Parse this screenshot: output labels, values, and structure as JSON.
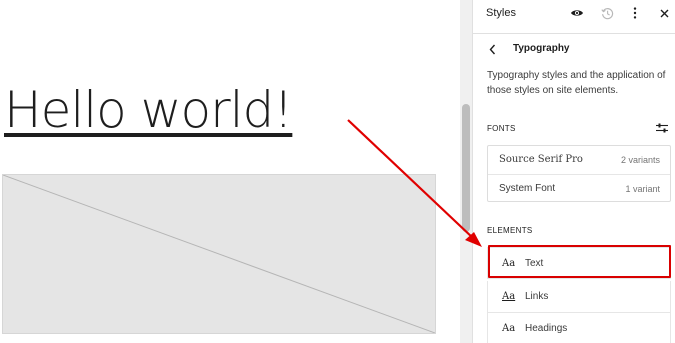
{
  "canvas": {
    "heading": "Hello world!"
  },
  "sidebar": {
    "title": "Styles",
    "icons": {
      "preview": "eye-icon",
      "revisions": "history-icon",
      "more": "more-vertical-icon",
      "close": "close-icon"
    },
    "panel_title": "Typography",
    "description": "Typography styles and the application of those styles on site elements.",
    "fonts_label": "FONTS",
    "fonts": [
      {
        "name": "Source Serif Pro",
        "variants": "2 variants"
      },
      {
        "name": "System Font",
        "variants": "1 variant"
      }
    ],
    "elements_label": "ELEMENTS",
    "elements": [
      {
        "icon": "Aa",
        "label": "Text"
      },
      {
        "icon": "Aa",
        "label": "Links"
      },
      {
        "icon": "Aa",
        "label": "Headings"
      }
    ]
  },
  "colors": {
    "highlight": "#d90000",
    "accent": "#1e1e1e"
  }
}
